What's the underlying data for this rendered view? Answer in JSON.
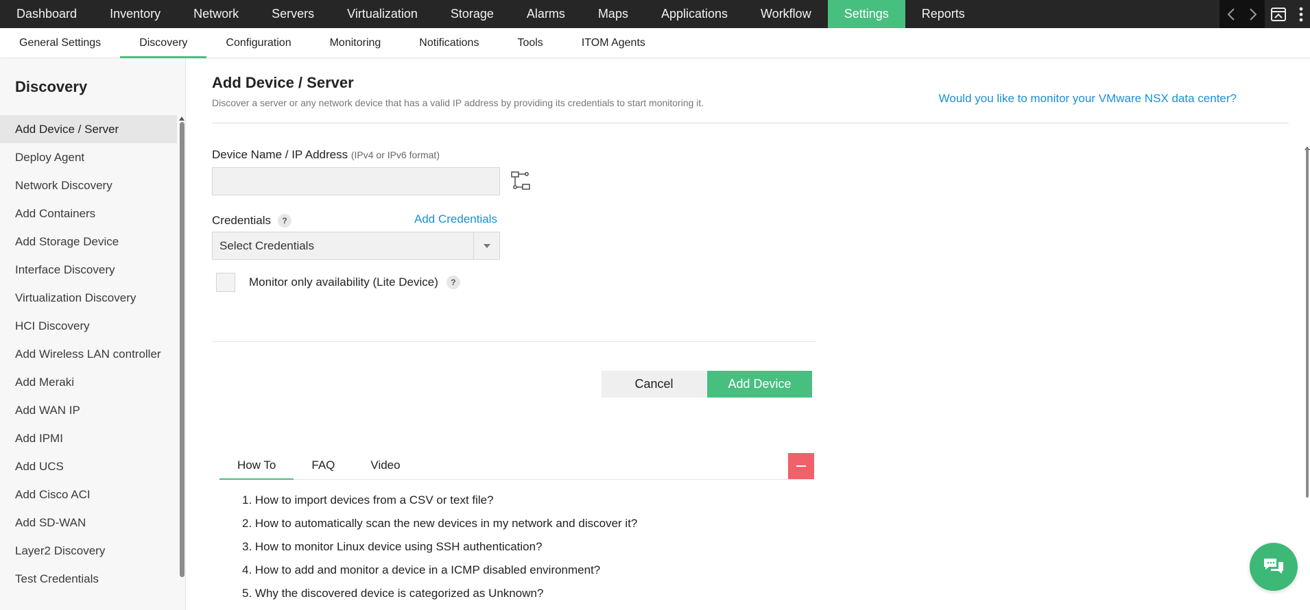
{
  "top_nav": {
    "items": [
      {
        "label": "Dashboard",
        "active": false
      },
      {
        "label": "Inventory",
        "active": false
      },
      {
        "label": "Network",
        "active": false
      },
      {
        "label": "Servers",
        "active": false
      },
      {
        "label": "Virtualization",
        "active": false
      },
      {
        "label": "Storage",
        "active": false
      },
      {
        "label": "Alarms",
        "active": false
      },
      {
        "label": "Maps",
        "active": false
      },
      {
        "label": "Applications",
        "active": false
      },
      {
        "label": "Workflow",
        "active": false
      },
      {
        "label": "Settings",
        "active": true
      },
      {
        "label": "Reports",
        "active": false
      }
    ],
    "tools": [
      "chevron-left-icon",
      "chevron-right-icon",
      "window-icon",
      "more-vertical-icon"
    ]
  },
  "sub_nav": {
    "items": [
      {
        "label": "General Settings",
        "active": false
      },
      {
        "label": "Discovery",
        "active": true
      },
      {
        "label": "Configuration",
        "active": false
      },
      {
        "label": "Monitoring",
        "active": false
      },
      {
        "label": "Notifications",
        "active": false
      },
      {
        "label": "Tools",
        "active": false
      },
      {
        "label": "ITOM Agents",
        "active": false
      }
    ]
  },
  "sidebar": {
    "title": "Discovery",
    "items": [
      {
        "label": "Add Device / Server",
        "active": true
      },
      {
        "label": "Deploy Agent",
        "active": false
      },
      {
        "label": "Network Discovery",
        "active": false
      },
      {
        "label": "Add Containers",
        "active": false
      },
      {
        "label": "Add Storage Device",
        "active": false
      },
      {
        "label": "Interface Discovery",
        "active": false
      },
      {
        "label": "Virtualization Discovery",
        "active": false
      },
      {
        "label": "HCI Discovery",
        "active": false
      },
      {
        "label": "Add Wireless LAN controller",
        "active": false
      },
      {
        "label": "Add Meraki",
        "active": false
      },
      {
        "label": "Add WAN IP",
        "active": false
      },
      {
        "label": "Add IPMI",
        "active": false
      },
      {
        "label": "Add UCS",
        "active": false
      },
      {
        "label": "Add Cisco ACI",
        "active": false
      },
      {
        "label": "Add SD-WAN",
        "active": false
      },
      {
        "label": "Layer2 Discovery",
        "active": false
      },
      {
        "label": "Test Credentials",
        "active": false
      }
    ]
  },
  "page": {
    "title": "Add Device / Server",
    "description": "Discover a server or any network device that has a valid IP address by providing its credentials to start monitoring it.",
    "nsx_link": "Would you like to monitor your VMware NSX data center?"
  },
  "form": {
    "ip_label": "Device Name / IP Address",
    "ip_hint": "(IPv4 or IPv6 format)",
    "ip_value": "",
    "credentials_label": "Credentials",
    "help_symbol": "?",
    "add_credentials": "Add Credentials",
    "credentials_selected": "Select Credentials",
    "lite_device_label": "Monitor only availability (Lite Device)",
    "lite_device_checked": false,
    "cancel_label": "Cancel",
    "add_device_label": "Add Device"
  },
  "howto": {
    "tabs": [
      {
        "label": "How To",
        "active": true
      },
      {
        "label": "FAQ",
        "active": false
      },
      {
        "label": "Video",
        "active": false
      }
    ],
    "items": [
      "1. How to import devices from a CSV or text file?",
      "2. How to automatically scan the new devices in my network and discover it?",
      "3. How to monitor Linux device using SSH authentication?",
      "4. How to add and monitor a device in a ICMP disabled environment?",
      "5. Why the discovered device is categorized as Unknown?"
    ]
  },
  "colors": {
    "accent_green": "#47bf7f",
    "link_blue": "#1a8fd6",
    "collapse_red": "#f0616a",
    "topbar_dark": "#262626"
  }
}
